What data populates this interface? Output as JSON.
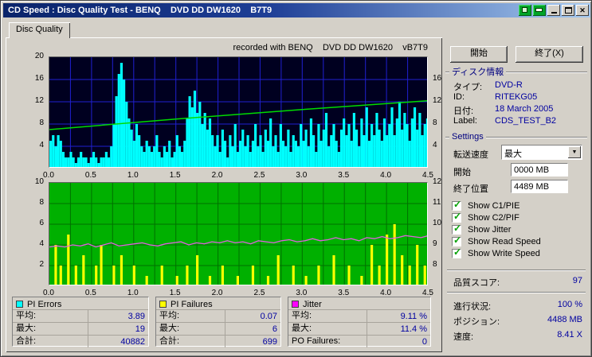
{
  "window": {
    "title": "CD Speed : Disc Quality Test - BENQ    DVD DD DW1620    B7T9"
  },
  "icons": {
    "close": "✕",
    "dropdown": "▼",
    "check": "✓"
  },
  "tab": {
    "label": "Disc Quality"
  },
  "main": {
    "recorded_with": "recorded with BENQ    DVD DD DW1620    vB7T9"
  },
  "colors": {
    "value_blue": "#0000a0",
    "check_green": "#00a000",
    "pi_errors": "#00ffff",
    "pi_failures": "#ffff00",
    "jitter": "#ff00ff"
  },
  "chart_data": [
    {
      "id": "pi-errors-chart",
      "type": "bar",
      "title": "PI Errors / Read Speed",
      "bg": "#000020",
      "grid_color": "#2020d0",
      "x_range": [
        0,
        4.5
      ],
      "x_grid_step": 0.25,
      "x_tick_step": 0.5,
      "x_ticks": [
        "0.0",
        "0.5",
        "1.0",
        "1.5",
        "2.0",
        "2.5",
        "3.0",
        "3.5",
        "4.0",
        "4.5"
      ],
      "y_left": {
        "range": [
          0,
          20
        ],
        "ticks": [
          20,
          16,
          12,
          8,
          4
        ]
      },
      "y_right": {
        "range": [
          0,
          20
        ],
        "ticks": [
          16,
          12,
          8,
          4
        ]
      },
      "series": [
        {
          "name": "PI Errors",
          "type": "bars",
          "color": "#00ffff",
          "values": [
            5,
            6,
            4,
            6,
            5,
            3,
            2,
            2,
            3,
            2,
            1,
            2,
            3,
            2,
            2,
            1,
            2,
            3,
            2,
            1,
            2,
            2,
            3,
            2,
            4,
            8,
            13,
            17,
            19,
            16,
            12,
            9,
            7,
            5,
            8,
            6,
            4,
            3,
            5,
            4,
            3,
            4,
            6,
            3,
            2,
            4,
            3,
            5,
            2,
            3,
            6,
            4,
            3,
            5,
            9,
            13,
            11,
            14,
            10,
            12,
            8,
            10,
            7,
            9,
            6,
            4,
            6,
            3,
            7,
            5,
            2,
            6,
            4,
            8,
            3,
            5,
            7,
            4,
            6,
            3,
            5,
            8,
            4,
            6,
            3,
            7,
            5,
            9,
            4,
            6,
            3,
            8,
            5,
            4,
            7,
            3,
            6,
            5,
            4,
            8,
            5,
            7,
            4,
            9,
            6,
            3,
            8,
            5,
            7,
            10,
            4,
            6,
            8,
            5,
            3,
            7,
            9,
            6,
            8,
            5,
            10,
            7,
            4,
            9,
            6,
            11,
            5,
            8,
            6,
            10,
            7,
            5,
            9,
            6,
            8,
            11,
            6,
            9,
            12,
            7,
            10,
            8,
            5,
            9,
            11,
            7,
            10,
            6,
            8,
            9
          ]
        },
        {
          "name": "Read Speed",
          "type": "line",
          "color": "#00dc00",
          "points": [
            [
              0,
              7.0
            ],
            [
              1.5,
              8.9
            ],
            [
              3.0,
              10.6
            ],
            [
              4.5,
              12.2
            ]
          ]
        }
      ]
    },
    {
      "id": "pi-failures-chart",
      "type": "bar",
      "title": "PI Failures / Jitter",
      "bg": "#00b000",
      "grid_color": "#007000",
      "x_range": [
        0,
        4.5
      ],
      "x_grid_step": 0.25,
      "x_tick_step": 0.5,
      "x_ticks": [
        "0.0",
        "0.5",
        "1.0",
        "1.5",
        "2.0",
        "2.5",
        "3.0",
        "3.5",
        "4.0",
        "4.5"
      ],
      "y_left": {
        "range": [
          0,
          10
        ],
        "ticks": [
          10,
          8,
          6,
          4,
          2
        ]
      },
      "y_right": {
        "range": [
          7,
          12
        ],
        "ticks": [
          12,
          11,
          10,
          9,
          8
        ]
      },
      "series": [
        {
          "name": "PI Failures",
          "type": "bars",
          "color": "#ffff00",
          "values": [
            0,
            0,
            4,
            0,
            2,
            0,
            0,
            5,
            0,
            0,
            2,
            0,
            0,
            3,
            0,
            0,
            0,
            0,
            2,
            0,
            4,
            0,
            0,
            0,
            0,
            2,
            0,
            0,
            3,
            0,
            0,
            0,
            0,
            2,
            0,
            0,
            0,
            0,
            1,
            0,
            0,
            0,
            0,
            0,
            2,
            0,
            0,
            0,
            0,
            0,
            1,
            0,
            0,
            0,
            2,
            0,
            0,
            0,
            3,
            0,
            0,
            0,
            0,
            1,
            0,
            0,
            0,
            0,
            2,
            0,
            0,
            0,
            0,
            0,
            1,
            0,
            0,
            0,
            0,
            0,
            2,
            0,
            0,
            0,
            0,
            0,
            1,
            0,
            0,
            0,
            3,
            0,
            0,
            0,
            0,
            0,
            2,
            0,
            0,
            0,
            0,
            1,
            0,
            0,
            0,
            0,
            2,
            0,
            0,
            0,
            0,
            0,
            3,
            0,
            0,
            0,
            0,
            0,
            2,
            0,
            0,
            0,
            0,
            1,
            0,
            0,
            0,
            4,
            0,
            0,
            2,
            0,
            0,
            5,
            0,
            0,
            6,
            0,
            0,
            3,
            0,
            0,
            2,
            0,
            0,
            4,
            0,
            0,
            2,
            0
          ]
        },
        {
          "name": "Jitter",
          "type": "jitter-line",
          "color": "#e060e0",
          "values": [
            8.9,
            8.95,
            8.9,
            9.0,
            8.95,
            9.05,
            8.9,
            9.0,
            9.1,
            8.95,
            9.0,
            9.05,
            9.1,
            9.0,
            8.95,
            9.05,
            9.1,
            9.15,
            9.0,
            9.1,
            9.05,
            9.15,
            9.1,
            9.2,
            9.1,
            9.15,
            9.05,
            9.2,
            9.15,
            9.1,
            9.2,
            9.25,
            9.15,
            9.2,
            9.3,
            9.2,
            9.25,
            9.35,
            9.25,
            9.3,
            9.2,
            9.35,
            9.3,
            9.4,
            9.3,
            9.35,
            9.45,
            9.4,
            9.35,
            9.45
          ]
        }
      ]
    }
  ],
  "legend": {
    "boxes": [
      {
        "title": "PI Errors",
        "swatch": "#00ffff",
        "rows": [
          {
            "label": "平均:",
            "value": "3.89"
          },
          {
            "label": "最大:",
            "value": "19"
          },
          {
            "label": "合計:",
            "value": "40882"
          }
        ]
      },
      {
        "title": "PI Failures",
        "swatch": "#ffff00",
        "rows": [
          {
            "label": "平均:",
            "value": "0.07"
          },
          {
            "label": "最大:",
            "value": "6"
          },
          {
            "label": "合計:",
            "value": "699"
          }
        ]
      },
      {
        "title": "Jitter",
        "swatch": "#ff00ff",
        "rows": [
          {
            "label": "平均:",
            "value": "9.11 %"
          },
          {
            "label": "最大:",
            "value": "11.4 %"
          },
          {
            "label": "PO Failures:",
            "value": "0"
          }
        ]
      }
    ]
  },
  "panel": {
    "start_button": "開始",
    "exit_button": "終了(X)",
    "disc_info": {
      "title": "ディスク情報",
      "rows": [
        {
          "label": "タイプ:",
          "value": "DVD-R"
        },
        {
          "label": "ID:",
          "value": "RITEKG05"
        },
        {
          "label": "日付:",
          "value": "18 March 2005"
        },
        {
          "label": "Label:",
          "value": "CDS_TEST_B2"
        }
      ]
    },
    "settings": {
      "title": "Settings",
      "speed_label": "転送速度",
      "speed_value": "最大",
      "start_label": "開始",
      "start_value": "0000 MB",
      "end_label": "終了位置",
      "end_value": "4489 MB",
      "checkboxes": [
        {
          "label": "Show C1/PIE",
          "checked": true
        },
        {
          "label": "Show C2/PIF",
          "checked": true
        },
        {
          "label": "Show Jitter",
          "checked": true
        },
        {
          "label": "Show Read Speed",
          "checked": true
        },
        {
          "label": "Show Write Speed",
          "checked": true
        }
      ]
    },
    "score_label": "品質スコア:",
    "score_value": "97",
    "progress_label": "進行状況:",
    "progress_value": "100 %",
    "position_label": "ポジション:",
    "position_value": "4488 MB",
    "speed_label": "速度:",
    "speed_value": "8.41 X"
  }
}
